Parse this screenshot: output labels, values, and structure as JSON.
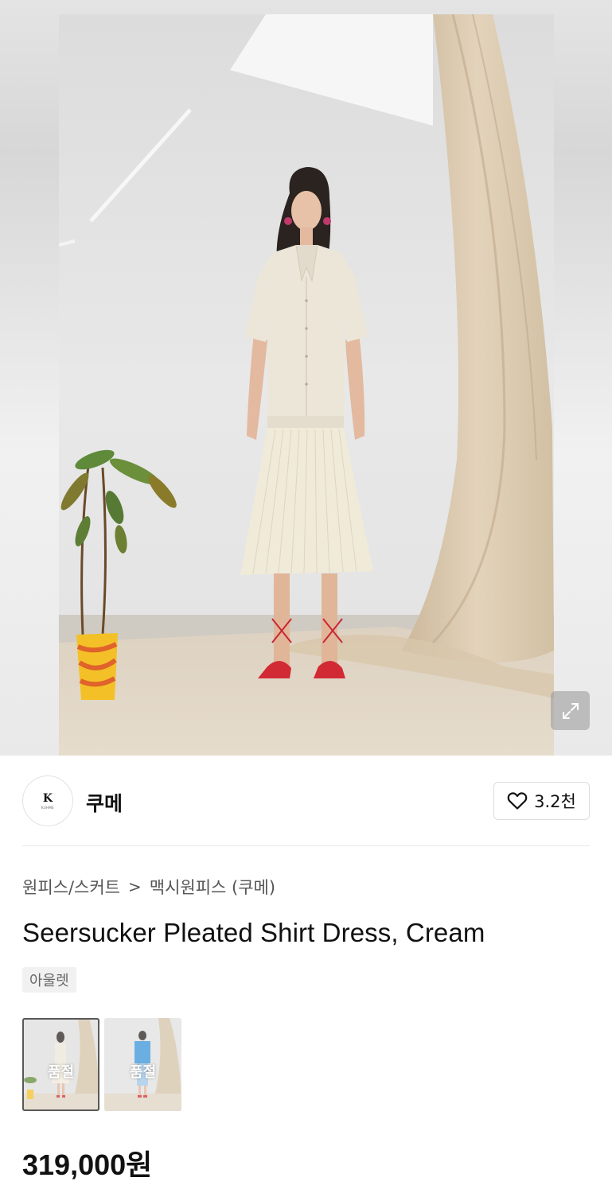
{
  "product": {
    "brand": {
      "name": "쿠메",
      "logo_mark": "K",
      "logo_sub": "KUHME"
    },
    "likes": {
      "count": "3.2천",
      "icon": "heart-outline-icon"
    },
    "breadcrumb": {
      "category": "원피스/스커트",
      "separator": ">",
      "subcategory": "맥시원피스 (쿠메)"
    },
    "title": "Seersucker Pleated Shirt Dress, Cream",
    "tag": "아울렛",
    "variants": [
      {
        "label": "품절",
        "color": "cream",
        "selected": true
      },
      {
        "label": "품절",
        "color": "blue",
        "selected": false
      }
    ],
    "price": "319,000원"
  },
  "hero": {
    "expand_icon": "expand-icon"
  }
}
